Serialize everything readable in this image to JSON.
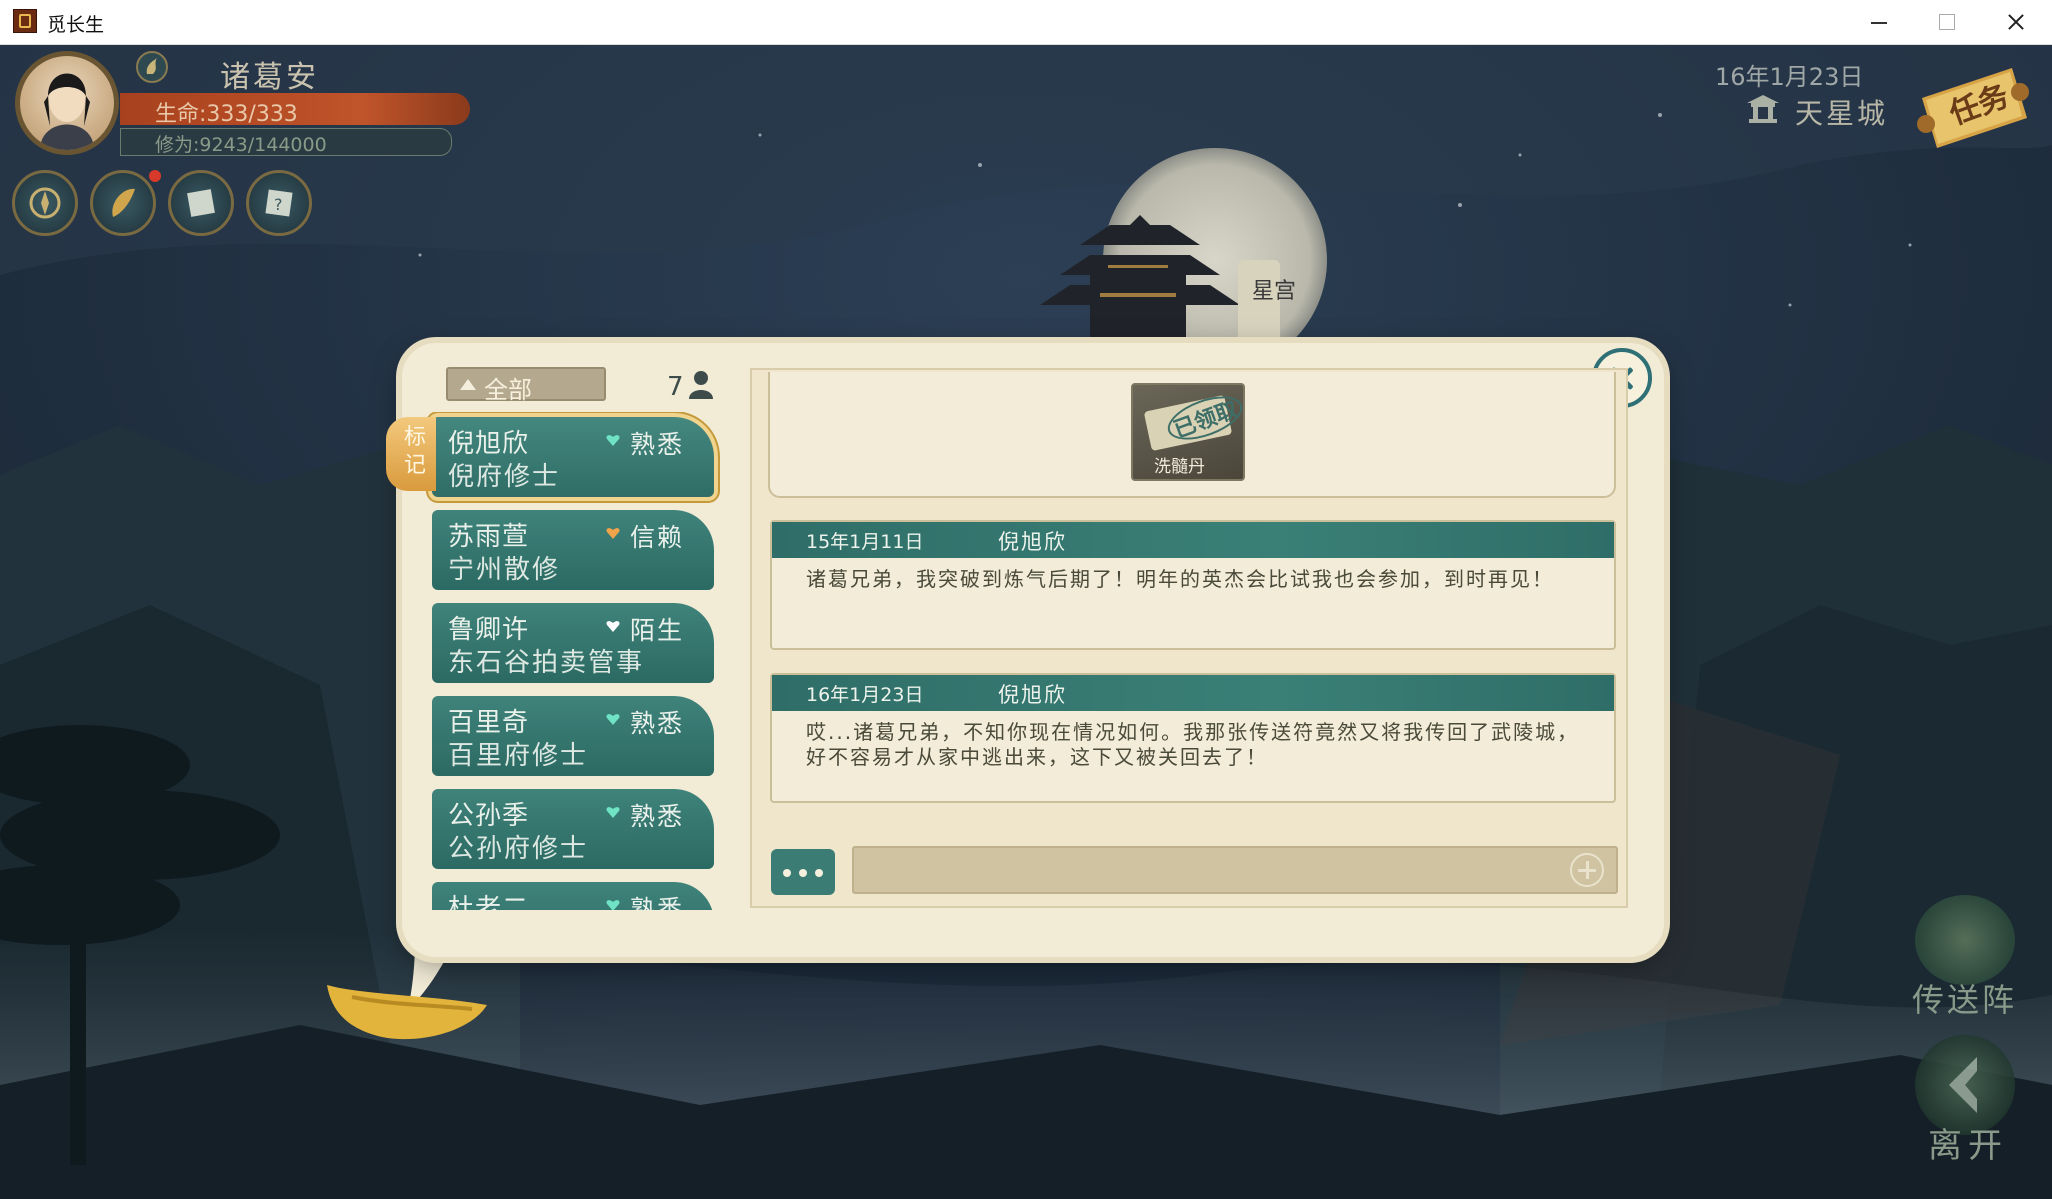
{
  "window": {
    "title": "觅长生"
  },
  "player": {
    "name": "诸葛安",
    "hp": "生命:333/333",
    "cultivation": "修为:9243/144000",
    "hp_fraction": 1.0,
    "cultivation_fraction": 0.064
  },
  "hud": {
    "icons": [
      "compass-icon",
      "talisman-icon",
      "map-scroll-icon",
      "help-scroll-icon"
    ]
  },
  "world": {
    "date": "16年1月23日",
    "location": "天星城",
    "quest_label": "任务"
  },
  "actions": {
    "teleport": "传送阵",
    "leave": "离开"
  },
  "scenery": {
    "pagoda_banner": "星宫"
  },
  "contacts": {
    "filter": "全部",
    "count": "7",
    "mark": "标记",
    "items": [
      {
        "name": "倪旭欣",
        "org": "倪府修士",
        "relation": "熟悉",
        "heart_color": "#6fe3c4"
      },
      {
        "name": "苏雨萱",
        "org": "宁州散修",
        "relation": "信赖",
        "heart_color": "#f2a44a"
      },
      {
        "name": "鲁卿许",
        "org": "东石谷拍卖管事",
        "relation": "陌生",
        "heart_color": "#ffffff"
      },
      {
        "name": "百里奇",
        "org": "百里府修士",
        "relation": "熟悉",
        "heart_color": "#6fe3c4"
      },
      {
        "name": "公孙季",
        "org": "公孙府修士",
        "relation": "熟悉",
        "heart_color": "#6fe3c4"
      },
      {
        "name": "杜老二",
        "org": "",
        "relation": "熟悉",
        "heart_color": "#6fe3c4"
      }
    ]
  },
  "gift": {
    "label": "洗髓丹",
    "stamp": "已领取"
  },
  "messages": [
    {
      "date": "15年1月11日",
      "sender": "倪旭欣",
      "text": "诸葛兄弟，我突破到炼气后期了！明年的英杰会比试我也会参加，到时再见！"
    },
    {
      "date": "16年1月23日",
      "sender": "倪旭欣",
      "text": "哎...诸葛兄弟，不知你现在情况如何。我那张传送符竟然又将我传回了武陵城，好不容易才从家中逃出来，这下又被关回去了！"
    }
  ],
  "colors": {
    "accent": "#2f6e68",
    "panel": "#f2ebd6",
    "hp": "#b84a23"
  }
}
